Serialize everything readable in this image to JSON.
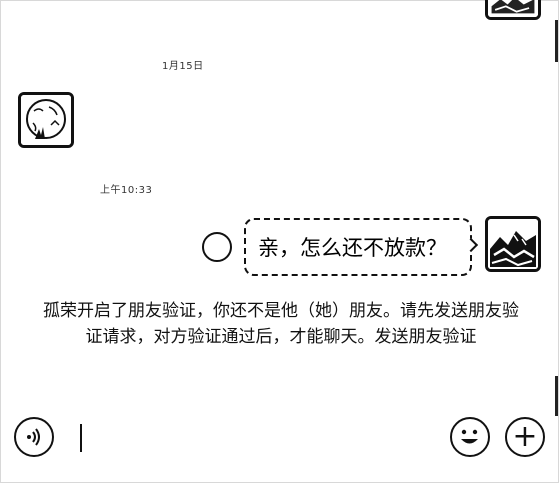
{
  "chat": {
    "timestamp_1": "1月15日",
    "timestamp_2": "上午10:33",
    "message": "亲，怎么还不放款？",
    "system_notice": "孤荣开启了朋友验证，你还不是他（她）朋友。请先发送朋友验证请求，对方验证通过后，才能聊天。发送朋友验证"
  },
  "input_bar": {
    "voice_icon": "voice-icon",
    "emoji_icon": "emoji-icon",
    "plus_icon": "plus-icon",
    "plus_glyph": "+",
    "value": ""
  }
}
